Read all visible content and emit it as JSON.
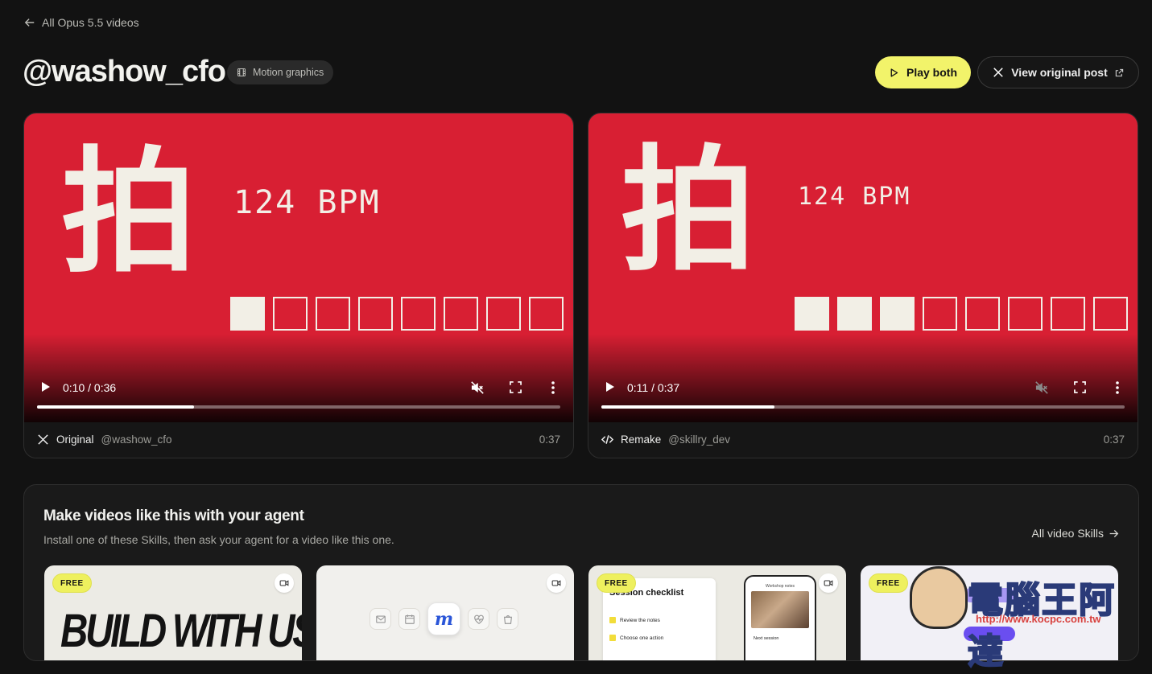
{
  "nav": {
    "back_label": "All Opus 5.5 videos"
  },
  "header": {
    "title": "@washow_cfo",
    "tag": "Motion graphics",
    "play_both": "Play both",
    "view_original": "View original post"
  },
  "videos": [
    {
      "glyph": "拍",
      "bpm": "124 BPM",
      "beats_total": 8,
      "beats_active": 1,
      "time": "0:10 / 0:36",
      "progress": 0.3,
      "kind": "Original",
      "handle": "@washow_cfo",
      "duration": "0:37"
    },
    {
      "glyph": "拍",
      "bpm": "124 BPM",
      "beats_total": 8,
      "beats_active": 3,
      "time": "0:11 / 0:37",
      "progress": 0.33,
      "kind": "Remake",
      "handle": "@skillry_dev",
      "duration": "0:37"
    }
  ],
  "skills": {
    "heading": "Make videos like this with your agent",
    "subheading": "Install one of these Skills, then ask your agent for a video like this one.",
    "all_link": "All video Skills",
    "cards": [
      {
        "badge": "FREE",
        "preview_text": "BUILD WITH US"
      },
      {
        "badge": "",
        "preview_text": "m"
      },
      {
        "badge": "FREE",
        "preview_text": "Session checklist",
        "items": [
          "Review the notes",
          "Choose one action"
        ],
        "phone_title": "Workshop notes",
        "phone_caption": "Next session"
      },
      {
        "badge": "FREE",
        "preview_text": ""
      }
    ]
  },
  "watermark": {
    "name": "電腦王阿達",
    "url": "http://www.kocpc.com.tw"
  },
  "colors": {
    "accent": "#f2f36a",
    "video_bg": "#d81f33",
    "page_bg": "#121212"
  }
}
